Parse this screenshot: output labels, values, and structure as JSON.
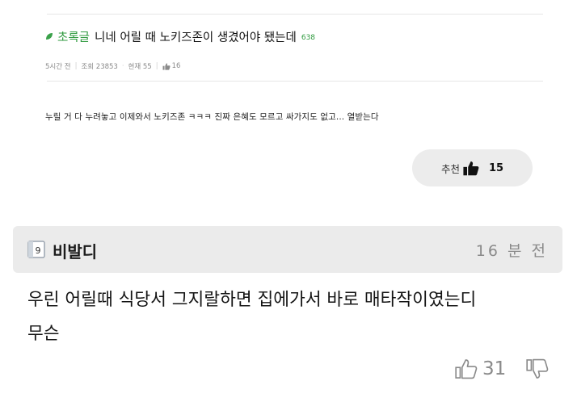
{
  "post": {
    "author": "초록글",
    "title": "니네 어릴 때 노키즈존이 생겼어야 됐는데",
    "comment_count": "638",
    "time_ago": "5시간 전",
    "views": "조회 23853",
    "current": "현재 55",
    "upvotes": "16",
    "body": "누릴 거 다 누려놓고 이제와서 노키즈존 ㅋㅋㅋ 진짜 은혜도 모르고 싸가지도 없고... 열받는다",
    "recommend_label": "추천",
    "recommend_count": "15"
  },
  "comment": {
    "avatar_label": "9",
    "author": "비발디",
    "time_ago": "16 분 전",
    "text": "우린 어릴때 식당서 그지랄하면 집에가서 바로 매타작이였는디\n무슨",
    "likes": "31"
  },
  "colors": {
    "accent_green": "#2f9a3f",
    "header_bg": "#ebebeb",
    "button_bg": "#ececec",
    "muted": "#8a8a8a"
  },
  "icons": {
    "leaf": "leaf-icon",
    "thumb_up_filled": "thumbs-up-filled-icon",
    "thumb_up_outline": "thumbs-up-outline-icon",
    "thumb_down_outline": "thumbs-down-outline-icon",
    "grade_badge": "level-badge-icon"
  }
}
